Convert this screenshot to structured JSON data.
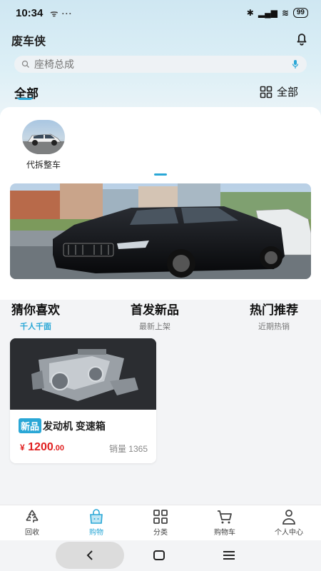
{
  "status_bar": {
    "time": "10:34",
    "extras": "ᯤ ···",
    "battery": "99"
  },
  "header": {
    "app_title": "废车侠"
  },
  "search": {
    "placeholder": "座椅总成"
  },
  "tabs": {
    "current": "全部",
    "all_categories": "全部"
  },
  "categories": [
    {
      "label": "代拆整车"
    }
  ],
  "sections": [
    {
      "title": "猜你喜欢",
      "subtitle": "千人千面",
      "active": true
    },
    {
      "title": "首发新品",
      "subtitle": "最新上架",
      "active": false
    },
    {
      "title": "热门推荐",
      "subtitle": "近期热销",
      "active": false
    }
  ],
  "products": [
    {
      "tag": "新品",
      "name": "发动机 变速箱",
      "currency": "¥",
      "price_int": "1200",
      "price_dec": ".00",
      "sales_label": "销量",
      "sales_count": "1365"
    }
  ],
  "bottom_nav": [
    {
      "label": "回收",
      "icon": "recycle-icon",
      "active": false
    },
    {
      "label": "购物",
      "icon": "shopping-bag-icon",
      "active": true
    },
    {
      "label": "分类",
      "icon": "category-grid-icon",
      "active": false
    },
    {
      "label": "购物车",
      "icon": "cart-icon",
      "active": false
    },
    {
      "label": "个人中心",
      "icon": "person-icon",
      "active": false
    }
  ],
  "colors": {
    "accent": "#2aa7d6",
    "price": "#e02020",
    "header_bg": "#cfe7f2"
  }
}
